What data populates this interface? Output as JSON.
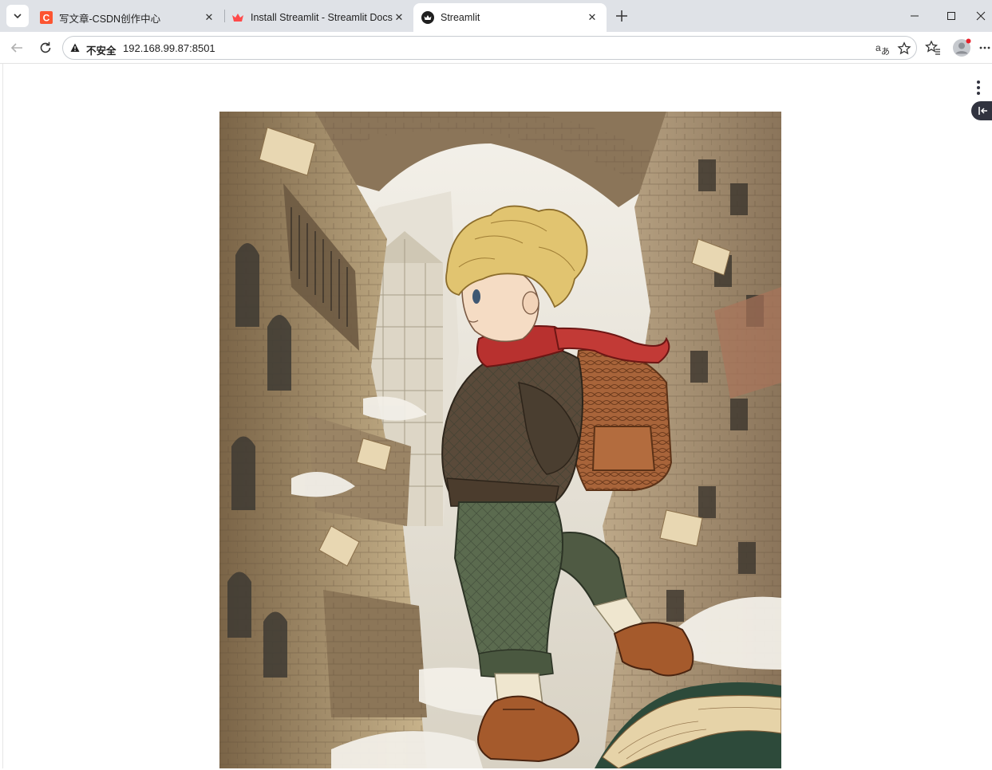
{
  "browser": {
    "tabs": [
      {
        "title": "写文章-CSDN创作中心",
        "favicon": "csdn-logo-icon",
        "active": false
      },
      {
        "title": "Install Streamlit - Streamlit Docs",
        "favicon": "streamlit-crown-icon",
        "active": false
      },
      {
        "title": "Streamlit",
        "favicon": "streamlit-app-icon",
        "active": true
      }
    ],
    "address_bar": {
      "security_label": "不安全",
      "url": "192.168.99.87:8501"
    },
    "icons": {
      "tab_search": "chevron-down-icon",
      "new_tab": "plus-icon",
      "back": "arrow-left-icon",
      "reload": "reload-icon",
      "security": "warning-triangle-icon",
      "translate": "translate-icon",
      "bookmark": "star-icon",
      "favorites": "favorites-icon",
      "profile": "profile-avatar-icon",
      "more": "more-horizontal-icon"
    }
  },
  "app": {
    "main_menu_icon": "more-vertical-icon",
    "sidebar_toggle_icon": "collapse-sidebar-icon",
    "image": {
      "subject": "illustration-boy-with-backpack-in-city"
    }
  },
  "colors": {
    "tabstrip_bg": "#dfe2e7",
    "csdn_red": "#fc5531",
    "streamlit_red": "#ff4b4b",
    "streamlit_dark": "#31333f",
    "profile_dot": "#e8202a"
  }
}
